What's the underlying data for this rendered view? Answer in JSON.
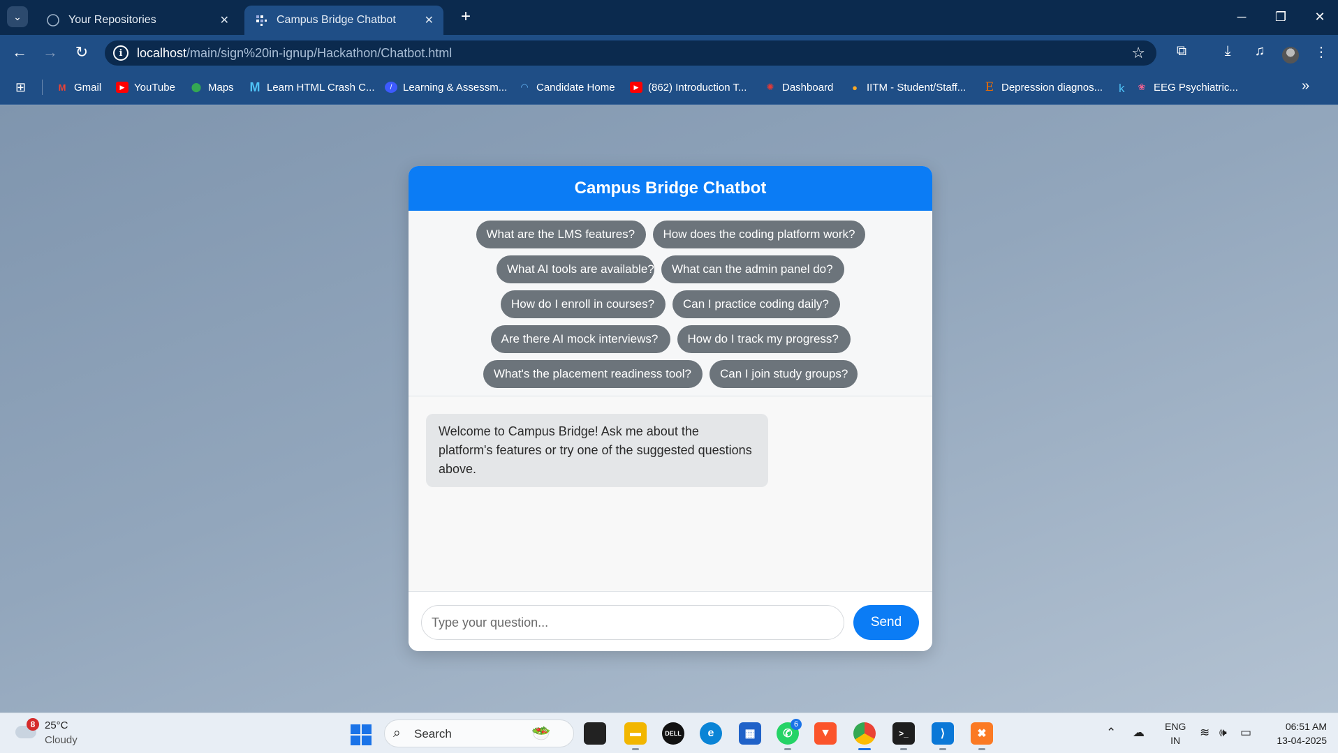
{
  "browser": {
    "tabs": [
      {
        "title": "Your Repositories",
        "icon": "github-icon",
        "active": false
      },
      {
        "title": "Campus Bridge Chatbot",
        "icon": "page-icon",
        "active": true
      }
    ],
    "url_host": "localhost",
    "url_path": "/main/sign%20in-ignup/Hackathon/Chatbot.html",
    "bookmarks": [
      {
        "label": "Gmail",
        "icon": "gmail-icon",
        "color": "#ea4335"
      },
      {
        "label": "YouTube",
        "icon": "youtube-icon",
        "color": "#ff0000"
      },
      {
        "label": "Maps",
        "icon": "maps-icon",
        "color": "#34a853"
      },
      {
        "label": "Learn HTML Crash C...",
        "icon": "m-icon",
        "color": "#4fc3f7"
      },
      {
        "label": "Learning & Assessm...",
        "icon": "learning-icon",
        "color": "#3d5afe"
      },
      {
        "label": "Candidate Home",
        "icon": "candidate-icon",
        "color": "#64b5f6"
      },
      {
        "label": "(862) Introduction T...",
        "icon": "youtube-icon",
        "color": "#ff0000"
      },
      {
        "label": "Dashboard",
        "icon": "dashboard-icon",
        "color": "#e53935"
      },
      {
        "label": "IITM - Student/Staff...",
        "icon": "iitm-icon",
        "color": "#f9a825"
      },
      {
        "label": "Depression diagnos...",
        "icon": "e-icon",
        "color": "#ef6c00"
      },
      {
        "label": "EEG Psychiatric...",
        "icon": "brain-icon",
        "color": "#f06292"
      }
    ]
  },
  "chat": {
    "title": "Campus Bridge Chatbot",
    "suggestions": [
      "What are the LMS features?",
      "How does the coding platform work?",
      "What AI tools are available?",
      "What can the admin panel do?",
      "How do I enroll in courses?",
      "Can I practice coding daily?",
      "Are there AI mock interviews?",
      "How do I track my progress?",
      "What's the placement readiness tool?",
      "Can I join study groups?"
    ],
    "welcome_message": "Welcome to Campus Bridge! Ask me about the platform's features or try one of the suggested questions above.",
    "input_placeholder": "Type your question...",
    "send_label": "Send",
    "accent_color": "#0b7cf5",
    "chip_color": "#6c747b"
  },
  "taskbar": {
    "weather_temp": "25°C",
    "weather_desc": "Cloudy",
    "weather_badge": "8",
    "search_label": "Search",
    "whatsapp_badge": "6",
    "lang_1": "ENG",
    "lang_2": "IN",
    "time": "06:51 AM",
    "date": "13-04-2025"
  }
}
